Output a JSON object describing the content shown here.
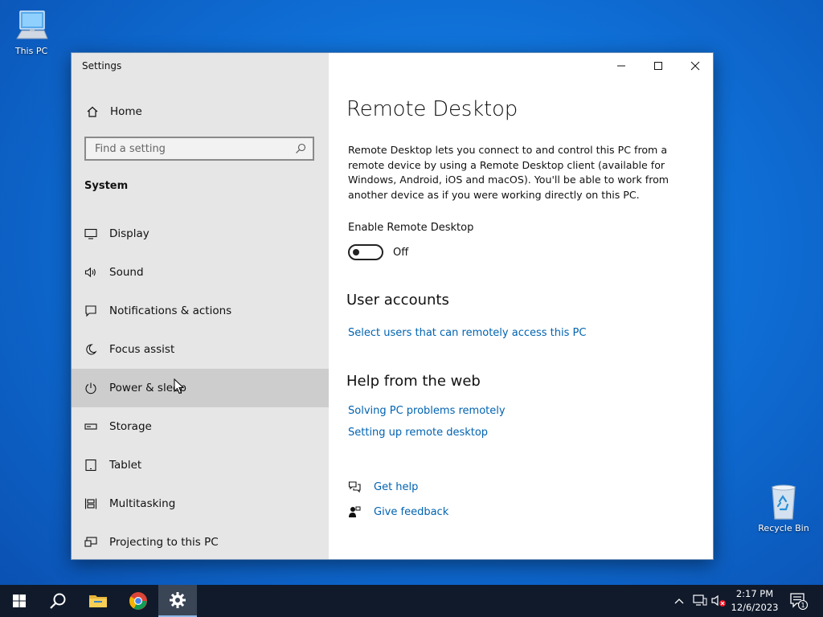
{
  "desktop": {
    "icons": [
      {
        "label": "This PC"
      },
      {
        "label": "Recycle Bin"
      }
    ]
  },
  "window": {
    "app_title": "Settings",
    "sidebar": {
      "home_label": "Home",
      "search_placeholder": "Find a setting",
      "section": "System",
      "items": [
        {
          "label": "Display",
          "icon": "display-icon"
        },
        {
          "label": "Sound",
          "icon": "sound-icon"
        },
        {
          "label": "Notifications & actions",
          "icon": "notifications-icon"
        },
        {
          "label": "Focus assist",
          "icon": "moon-icon"
        },
        {
          "label": "Power & sleep",
          "icon": "power-icon",
          "hovered": true
        },
        {
          "label": "Storage",
          "icon": "storage-icon"
        },
        {
          "label": "Tablet",
          "icon": "tablet-icon"
        },
        {
          "label": "Multitasking",
          "icon": "multitasking-icon"
        },
        {
          "label": "Projecting to this PC",
          "icon": "projecting-icon"
        }
      ]
    },
    "content": {
      "title": "Remote Desktop",
      "description": "Remote Desktop lets you connect to and control this PC from a remote device by using a Remote Desktop client (available for Windows, Android, iOS and macOS). You'll be able to work from another device as if you were working directly on this PC.",
      "enable_label": "Enable Remote Desktop",
      "toggle_state": "Off",
      "user_accounts_heading": "User accounts",
      "user_accounts_link": "Select users that can remotely access this PC",
      "help_heading": "Help from the web",
      "help_links": [
        "Solving PC problems remotely",
        "Setting up remote desktop"
      ],
      "get_help": "Get help",
      "give_feedback": "Give feedback"
    }
  },
  "taskbar": {
    "time": "2:17 PM",
    "date": "12/6/2023",
    "notification_count": "1"
  },
  "colors": {
    "link": "#0063b1",
    "sidebar_bg": "#e6e6e6",
    "taskbar_bg": "#101a2b"
  }
}
